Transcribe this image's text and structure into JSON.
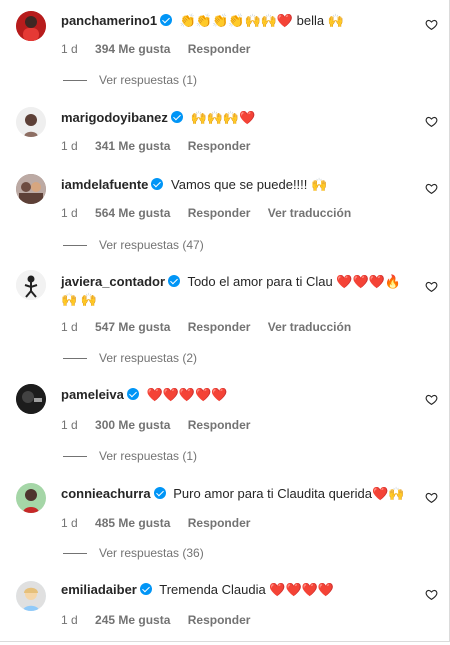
{
  "labels": {
    "like_suffix": "Me gusta",
    "reply": "Responder",
    "translate": "Ver traducción",
    "view_replies_prefix": "Ver respuestas"
  },
  "comments": [
    {
      "username": "panchamerino1",
      "verified": true,
      "text": "👏👏👏👏🙌🙌❤️ bella 🙌",
      "time": "1 d",
      "likes": "394 Me gusta",
      "reply": "Responder",
      "translate": "",
      "replies": "Ver respuestas (1)"
    },
    {
      "username": "marigodoyibanez",
      "verified": true,
      "text": "🙌🙌🙌❤️",
      "time": "1 d",
      "likes": "341 Me gusta",
      "reply": "Responder",
      "translate": "",
      "replies": ""
    },
    {
      "username": "iamdelafuente",
      "verified": true,
      "text": "Vamos que se puede!!!! 🙌",
      "time": "1 d",
      "likes": "564 Me gusta",
      "reply": "Responder",
      "translate": "Ver traducción",
      "replies": "Ver respuestas (47)"
    },
    {
      "username": "javiera_contador",
      "verified": true,
      "text": "Todo el amor para ti Clau ❤️❤️❤️🔥🙌 🙌",
      "time": "1 d",
      "likes": "547 Me gusta",
      "reply": "Responder",
      "translate": "Ver traducción",
      "replies": "Ver respuestas (2)"
    },
    {
      "username": "pameleiva",
      "verified": true,
      "text": "❤️❤️❤️❤️❤️",
      "time": "1 d",
      "likes": "300 Me gusta",
      "reply": "Responder",
      "translate": "",
      "replies": "Ver respuestas (1)"
    },
    {
      "username": "connieachurra",
      "verified": true,
      "text": "Puro amor para ti Claudita querida❤️🙌",
      "time": "1 d",
      "likes": "485 Me gusta",
      "reply": "Responder",
      "translate": "",
      "replies": "Ver respuestas (36)"
    },
    {
      "username": "emiliadaiber",
      "verified": true,
      "text": "Tremenda Claudia ❤️❤️❤️❤️",
      "time": "1 d",
      "likes": "245 Me gusta",
      "reply": "Responder",
      "translate": "",
      "replies": ""
    }
  ],
  "colors": {
    "verified": "#0095f6",
    "meta": "#737373",
    "text": "#262626",
    "border": "#dbdbdb"
  },
  "icons": {
    "like": "heart-outline-icon",
    "verified": "verified-badge-icon"
  }
}
